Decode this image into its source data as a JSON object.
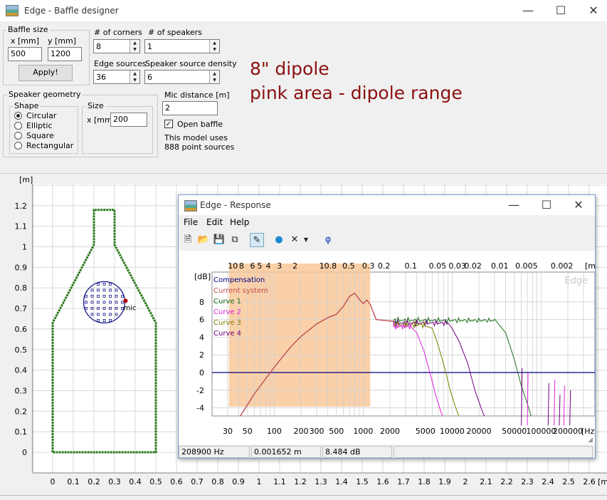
{
  "window": {
    "title": "Edge - Baffle designer"
  },
  "baffle_size": {
    "label": "Baffle size",
    "x_label": "x [mm]",
    "y_label": "y [mm]",
    "x_value": "500",
    "y_value": "1200",
    "apply_label": "Apply!"
  },
  "corners": {
    "label": "# of corners",
    "value": "8"
  },
  "speakers": {
    "label": "# of speakers",
    "value": "1"
  },
  "edge_sources": {
    "label": "Edge sources",
    "value": "36"
  },
  "source_density": {
    "label": "Speaker source density",
    "value": "6"
  },
  "geometry": {
    "label": "Speaker geometry",
    "shape_label": "Shape",
    "shapes": [
      {
        "label": "Circular",
        "selected": true
      },
      {
        "label": "Elliptic",
        "selected": false
      },
      {
        "label": "Square",
        "selected": false
      },
      {
        "label": "Rectangular",
        "selected": false
      }
    ],
    "size_label": "Size",
    "size_x_label": "x [mm]",
    "size_x_value": "200"
  },
  "mic": {
    "label": "Mic distance [m]",
    "value": "2",
    "open_baffle_label": "Open baffle",
    "open_baffle_checked": true
  },
  "model_info": {
    "line1": "This model uses",
    "line2": "888 point sources"
  },
  "annotation": {
    "line1": "8\" dipole",
    "line2": "pink area - dipole range",
    "color": "#8b1010"
  },
  "baffle_plot": {
    "y_unit": "[m]",
    "x_unit": "[m",
    "y_ticks": [
      "1.2",
      "1.1",
      "1",
      "0.9",
      "0.8",
      "0.7",
      "0.6",
      "0.5",
      "0.4",
      "0.3",
      "0.2",
      "0.1",
      "0"
    ],
    "x_ticks": [
      "0",
      "0.1",
      "0.2",
      "0.3",
      "0.4",
      "0.5",
      "0.6",
      "0.7",
      "0.8",
      "0.9",
      "1",
      "1.1",
      "1.2",
      "1.3",
      "1.4",
      "1.5",
      "1.6",
      "1.7",
      "1.8",
      "1.9",
      "2",
      "2.1",
      "2.2",
      "2.3",
      "2.4",
      "2.5",
      "2.6"
    ],
    "mic_label": "mic",
    "outline_color": "#2a7a1a"
  },
  "response": {
    "title": "Edge - Response",
    "menu": [
      "File",
      "Edit",
      "Help"
    ],
    "toolbar_icons": [
      "new-icon",
      "open-icon",
      "save-icon",
      "copy-icon",
      "pen-icon",
      "speaker-icon",
      "delete-icon",
      "dropdown-icon",
      "phase-icon"
    ],
    "phase_symbol": "φ",
    "watermark": "Edge",
    "db_unit": "[dB]",
    "top_unit": "[m",
    "hz_unit": "[Hz]",
    "legend": [
      {
        "label": "Compensation",
        "color": "#000080"
      },
      {
        "label": "Current system",
        "color": "#c0504d"
      },
      {
        "label": "Curve 1",
        "color": "#1a6e1a"
      },
      {
        "label": "Curve 2",
        "color": "#e020e0"
      },
      {
        "label": "Curve 3",
        "color": "#808000"
      },
      {
        "label": "Curve 4",
        "color": "#700080"
      }
    ],
    "y_ticks": [
      "8",
      "6",
      "4",
      "2",
      "0",
      "-2",
      "-4"
    ],
    "x_ticks": [
      "30",
      "50",
      "100",
      "200",
      "300",
      "500",
      "1000",
      "2000",
      "5000",
      "10000",
      "20000",
      "50000",
      "100000",
      "200000"
    ],
    "top_ticks": [
      "10",
      "8",
      "6",
      "5",
      "4",
      "3",
      "2",
      "1",
      "0.8",
      "0.5",
      "0.3",
      "0.2",
      "0.1",
      "0.05",
      "0.03",
      "0.02",
      "0.01",
      "0.005",
      "0.002"
    ],
    "highlight_color": "#f9c89a",
    "status": {
      "freq": "208900 Hz",
      "dist": "0.001652 m",
      "level": "8.484 dB"
    }
  }
}
